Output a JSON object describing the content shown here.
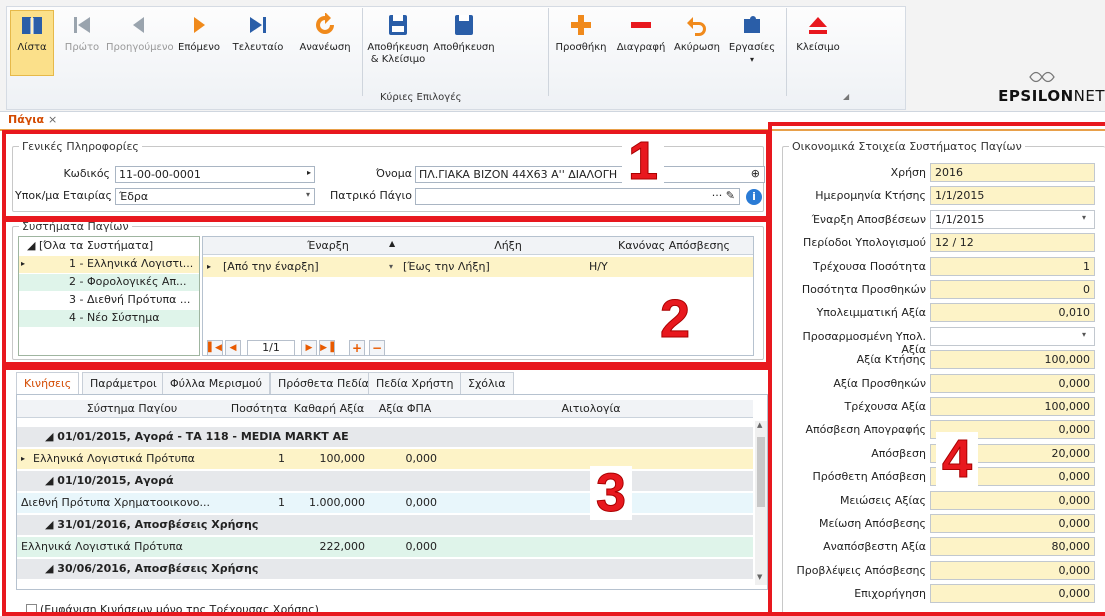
{
  "ribbon": {
    "buttons": [
      {
        "label": "Λίστα",
        "icon": "book-icon"
      },
      {
        "label": "Πρώτο",
        "icon": "first-icon"
      },
      {
        "label": "Προηγούμενο",
        "icon": "previous-icon"
      },
      {
        "label": "Επόμενο",
        "icon": "next-icon"
      },
      {
        "label": "Τελευταίο",
        "icon": "last-icon"
      },
      {
        "label": "Ανανέωση",
        "icon": "refresh-icon"
      },
      {
        "label": "Αποθήκευση & Κλείσιμο",
        "icon": "save-close-icon"
      },
      {
        "label": "Αποθήκευση",
        "icon": "save-icon"
      },
      {
        "label": "Προσθήκη",
        "icon": "plus-icon"
      },
      {
        "label": "Διαγραφή",
        "icon": "minus-icon"
      },
      {
        "label": "Ακύρωση",
        "icon": "undo-icon"
      },
      {
        "label": "Εργασίες",
        "icon": "puzzle-icon"
      },
      {
        "label": "Κλείσιμο",
        "icon": "eject-icon"
      }
    ],
    "group_label": "Κύριες Επιλογές",
    "brand": "EPSILONNET",
    "brand_a": "EPSILON",
    "brand_b": "NET"
  },
  "tab": {
    "label": "Πάγια",
    "close": "×"
  },
  "general": {
    "title": "Γενικές Πληροφορίες",
    "code_label": "Κωδικός",
    "code_value": "11-00-00-0001",
    "name_label": "Όνομα",
    "name_value": "ΠΛ.ΓΙΑΚΑ ΒΙΖΟΝ 44Χ63 Α'' ΔΙΑΛΟΓΗ",
    "branch_label": "Υποκ/μα Εταιρίας",
    "branch_value": "Έδρα",
    "parent_label": "Πατρικό Πάγιο",
    "parent_value": ""
  },
  "systems": {
    "title": "Συστήματα Παγίων",
    "tree": [
      "[Όλα τα Συστήματα]",
      "1 - Ελληνικά Λογιστι...",
      "2 - Φορολογικές Απ...",
      "3 - Διεθνή Πρότυπα ...",
      "4 - Νέο Σύστημα"
    ],
    "cols": [
      "Έναρξη",
      "Λήξη",
      "Κανόνας Απόσβεσης"
    ],
    "row": [
      "[Από την έναρξη]",
      "[Έως την Λήξη]",
      "Η/Υ"
    ],
    "pager": "1/1"
  },
  "tabs": [
    "Κινήσεις",
    "Παράμετροι",
    "Φύλλα Μερισμού",
    "Πρόσθετα Πεδία",
    "Πεδία Χρήστη",
    "Σχόλια"
  ],
  "movements": {
    "cols": [
      "Σύστημα Παγίου",
      "Ποσότητα",
      "Καθαρή Αξία",
      "Αξία ΦΠΑ",
      "Αιτιολογία"
    ],
    "groups": [
      {
        "title": "01/01/2015, Αγορά - ΤΑ 118 - MEDIA MARKT AE",
        "row": [
          "Ελληνικά Λογιστικά Πρότυπα",
          "1",
          "100,000",
          "0,000",
          ""
        ]
      },
      {
        "title": "01/10/2015, Αγορά",
        "row": [
          "Διεθνή Πρότυπα Χρηματοοικονο...",
          "1",
          "1.000,000",
          "0,000",
          ""
        ]
      },
      {
        "title": "31/01/2016, Αποσβέσεις Χρήσης",
        "row": [
          "Ελληνικά Λογιστικά Πρότυπα",
          "",
          "222,000",
          "0,000",
          ""
        ]
      },
      {
        "title": "30/06/2016, Αποσβέσεις Χρήσης",
        "row": [
          "",
          "",
          "",
          "",
          ""
        ]
      }
    ],
    "checkbox_label": "(Εμφάνιση Κινήσεων μόνο της Τρέχουσας Χρήσης)"
  },
  "financial": {
    "title": "Οικονομικά Στοιχεία Συστήματος Παγίων",
    "fields": [
      {
        "label": "Χρήση",
        "value": "2016"
      },
      {
        "label": "Ημερομηνία Κτήσης",
        "value": "1/1/2015"
      },
      {
        "label": "Έναρξη Αποσβέσεων",
        "value": "1/1/2015"
      },
      {
        "label": "Περίοδοι Υπολογισμού",
        "value": "12 / 12"
      },
      {
        "label": "Τρέχουσα Ποσότητα",
        "value": "1"
      },
      {
        "label": "Ποσότητα Προσθηκών",
        "value": "0"
      },
      {
        "label": "Υπολειμματική Αξία",
        "value": "0,010"
      },
      {
        "label": "Προσαρμοσμένη Υπολ. Αξία",
        "value": ""
      },
      {
        "label": "Αξία Κτήσης",
        "value": "100,000"
      },
      {
        "label": "Αξία Προσθηκών",
        "value": "0,000"
      },
      {
        "label": "Τρέχουσα Αξία",
        "value": "100,000"
      },
      {
        "label": "Απόσβεση Απογραφής",
        "value": "0,000"
      },
      {
        "label": "Απόσβεση",
        "value": "20,000"
      },
      {
        "label": "Πρόσθετη Απόσβεση",
        "value": "0,000"
      },
      {
        "label": "Μειώσεις Αξίας",
        "value": "0,000"
      },
      {
        "label": "Μείωση Απόσβεσης",
        "value": "0,000"
      },
      {
        "label": "Αναπόσβεστη Αξία",
        "value": "80,000"
      },
      {
        "label": "Προβλέψεις Απόσβεσης",
        "value": "0,000"
      },
      {
        "label": "Επιχορήγηση",
        "value": "0,000"
      }
    ]
  },
  "callouts": [
    "1",
    "2",
    "3",
    "4"
  ]
}
